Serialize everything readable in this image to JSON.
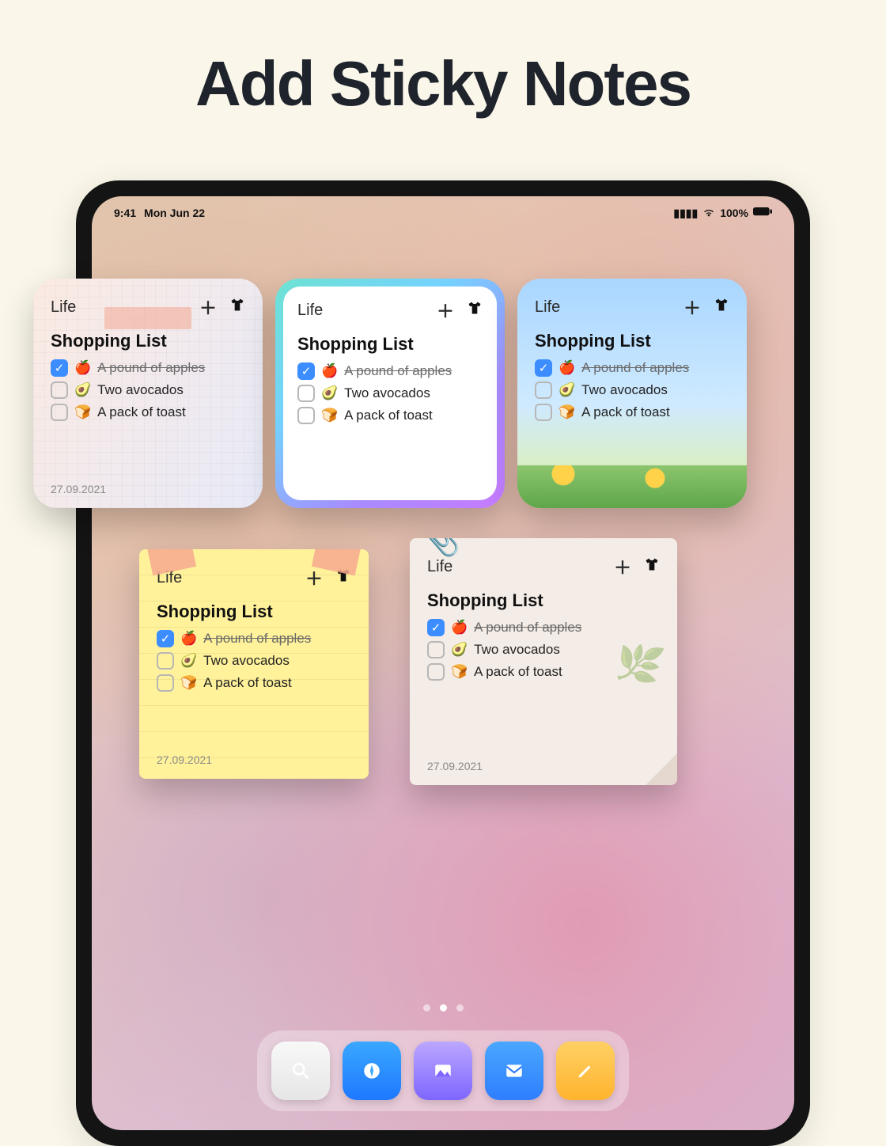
{
  "headline": "Add Sticky Notes",
  "status": {
    "time": "9:41",
    "date": "Mon Jun 22",
    "battery": "100%"
  },
  "common_note": {
    "category": "Life",
    "title": "Shopping List",
    "date": "27.09.2021",
    "items": [
      {
        "emoji": "🍎",
        "text": "A pound of apples",
        "done": true
      },
      {
        "emoji": "🥑",
        "text": "Two avocados",
        "done": false
      },
      {
        "emoji": "🍞",
        "text": "A pack of toast",
        "done": false
      }
    ]
  },
  "dock": {
    "apps": [
      "search",
      "safari",
      "photos",
      "mail",
      "notes"
    ]
  },
  "pager": {
    "count": 3,
    "active": 1
  }
}
